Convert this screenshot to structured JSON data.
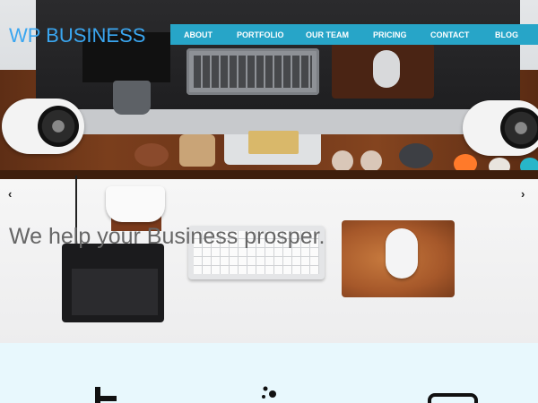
{
  "header": {
    "logo": "WP BUSINESS",
    "nav": [
      {
        "label": "ABOUT"
      },
      {
        "label": "PORTFOLIO"
      },
      {
        "label": "OUR TEAM"
      },
      {
        "label": "PRICING"
      },
      {
        "label": "CONTACT"
      },
      {
        "label": "BLOG"
      }
    ]
  },
  "hero": {
    "tagline": "We help your Business prosper.",
    "prev_icon": "chevron-left-icon",
    "next_icon": "chevron-right-icon"
  },
  "features": {
    "icons": [
      "tower-icon",
      "flask-icon",
      "device-icon"
    ]
  },
  "colors": {
    "accent": "#27a5c8",
    "logo": "#3aa6f0",
    "tagline": "#666666",
    "features_bg": "#e8f8fd"
  }
}
